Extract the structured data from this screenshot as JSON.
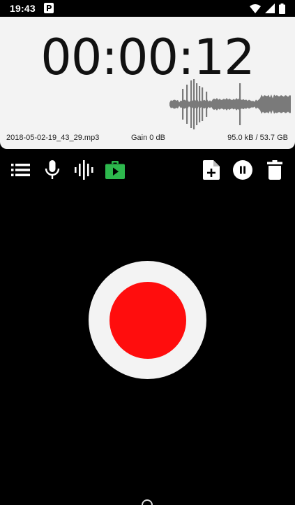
{
  "status_bar": {
    "time": "19:43",
    "icons": [
      "parking-app-icon",
      "wifi-icon",
      "signal-icon",
      "battery-icon"
    ]
  },
  "recorder": {
    "elapsed": "00:00:12",
    "file_name": "2018-05-02-19_43_29.mp3",
    "gain": "Gain 0 dB",
    "size": "95.0 kB / 53.7 GB"
  },
  "toolbar": {
    "left": [
      "list-icon",
      "microphone-icon",
      "waveform-icon",
      "encoder-icon"
    ],
    "right": [
      "new-file-icon",
      "pause-icon",
      "trash-icon"
    ]
  },
  "colors": {
    "panel": "#f3f3f3",
    "record": "#ff0d0d",
    "accent_green": "#2db84d",
    "wave": "#7a7a7a"
  }
}
